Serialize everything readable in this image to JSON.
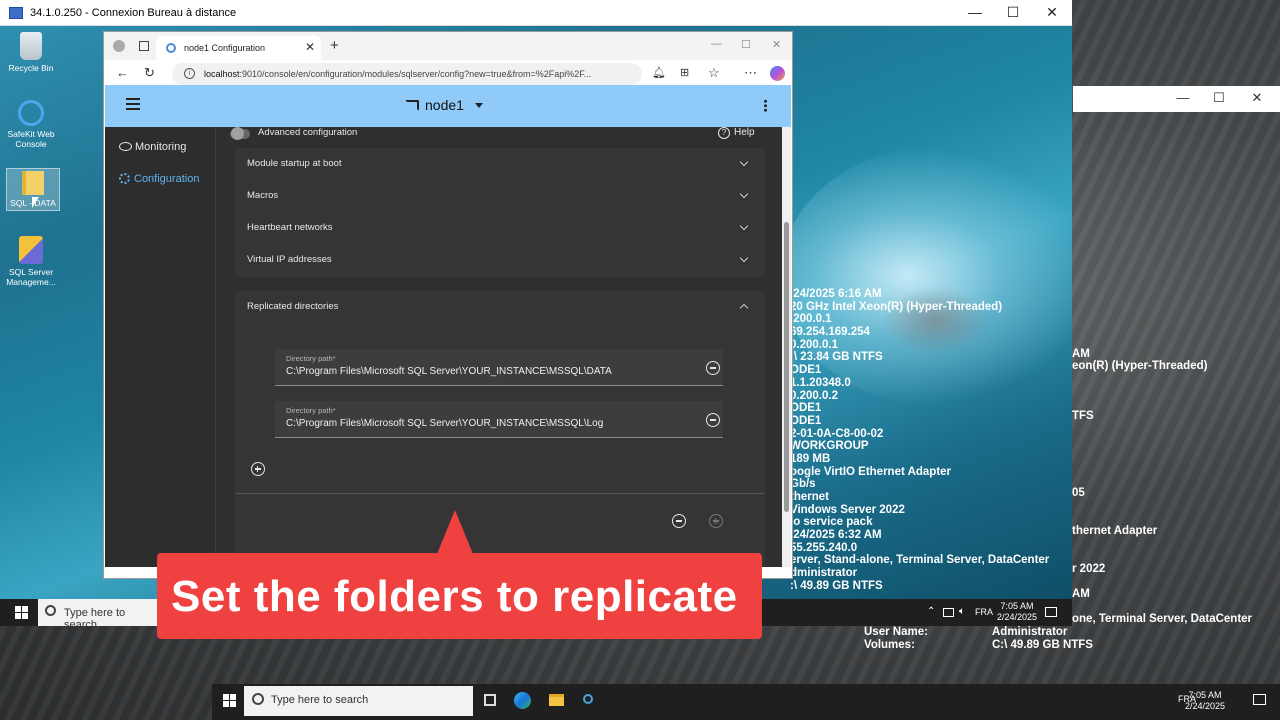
{
  "rdp_window": {
    "title": "34.1.0.250 - Connexion Bureau à distance",
    "min": "—",
    "max": "☐",
    "close": "✕"
  },
  "desktop_icons": [
    {
      "label": "Recycle Bin"
    },
    {
      "label": "SafeKit Web Console"
    },
    {
      "label": "SQL - DATA"
    },
    {
      "label": "SQL Server Manageme..."
    }
  ],
  "sysinfo1": [
    "/24/2025 6:16 AM",
    "20 GHz Intel Xeon(R) (Hyper-Threaded)",
    ".200.0.1",
    "69.254.169.254",
    "0.200.0.1",
    ":\\ 23.84 GB NTFS",
    "ODE1",
    "1.1.20348.0",
    "0.200.0.2",
    "ODE1",
    "ODE1",
    "2-01-0A-C8-00-02",
    "WORKGROUP",
    "189 MB",
    "oogle VirtIO Ethernet Adapter",
    " Gb/s",
    "thernet",
    "Vindows Server 2022",
    "lo service pack",
    "/24/2025 6:32 AM",
    "55.255.240.0",
    "erver, Stand-alone, Terminal Server, DataCenter",
    "dministrator",
    ":\\ 49.89 GB NTFS"
  ],
  "win2_info": {
    "am": "AM",
    "cpu": "eon(R) (Hyper-Threaded)",
    "tfs": "TFS",
    "y05": "05",
    "eth": "thernet Adapter",
    "os": "r 2022",
    "am2": "AM",
    "role": "one, Terminal Server, DataCenter",
    "user_label": "User Name:",
    "user_value": "Administrator",
    "vol_label": "Volumes:",
    "vol_value": "C:\\ 49.89 GB NTFS"
  },
  "taskbar1": {
    "search_placeholder": "Type here to search",
    "lang": "FRA",
    "time": "7:05 AM",
    "date": "2/24/2025"
  },
  "taskbar2": {
    "search_placeholder": "Type here to search",
    "lang": "FRA",
    "time": "7:05 AM",
    "date": "2/24/2025"
  },
  "browser": {
    "tab_title": "node1 Configuration",
    "tab_close": "✕",
    "new_tab": "+",
    "url_host": "localhost",
    "url_rest": ":9010/console/en/configuration/modules/sqlserver/config?new=true&from=%2Fapi%2F...",
    "min": "—",
    "max": "☐",
    "close": "✕"
  },
  "app": {
    "node_name": "node1",
    "nav": {
      "monitoring": "Monitoring",
      "configuration": "Configuration"
    },
    "advanced_config": "Advanced configuration",
    "help": "Help",
    "sections": [
      {
        "label": "Module startup at boot"
      },
      {
        "label": "Macros"
      },
      {
        "label": "Heartbeart networks"
      },
      {
        "label": "Virtual IP addresses"
      }
    ],
    "replicated": {
      "title": "Replicated directories",
      "fields": [
        {
          "label": "Directory path*",
          "value": "C:\\Program Files\\Microsoft SQL Server\\YOUR_INSTANCE\\MSSQL\\DATA"
        },
        {
          "label": "Directory path*",
          "value": "C:\\Program Files\\Microsoft SQL Server\\YOUR_INSTANCE\\MSSQL\\Log"
        }
      ]
    }
  },
  "caption": "Set the folders to replicate"
}
